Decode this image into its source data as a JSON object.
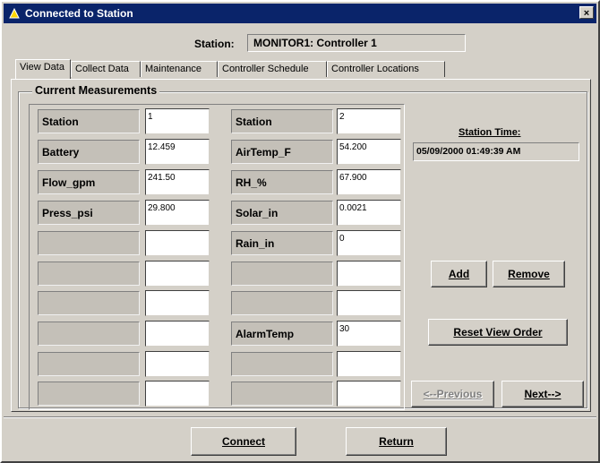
{
  "window": {
    "title": "Connected to Station",
    "close_glyph": "×"
  },
  "station": {
    "label": "Station:",
    "value": "MONITOR1: Controller 1"
  },
  "tabs": [
    {
      "label": "View Data"
    },
    {
      "label": "Collect Data"
    },
    {
      "label": "Maintenance"
    },
    {
      "label": "Controller Schedule"
    },
    {
      "label": "Controller Locations"
    }
  ],
  "group": {
    "label": "Current Measurements"
  },
  "left_column": [
    {
      "label": "Station",
      "value": "1"
    },
    {
      "label": "Battery",
      "value": "12.459"
    },
    {
      "label": "Flow_gpm",
      "value": "241.50"
    },
    {
      "label": "Press_psi",
      "value": "29.800"
    },
    {
      "label": "",
      "value": ""
    },
    {
      "label": "",
      "value": ""
    },
    {
      "label": "",
      "value": ""
    },
    {
      "label": "",
      "value": ""
    },
    {
      "label": "",
      "value": ""
    },
    {
      "label": "",
      "value": ""
    }
  ],
  "right_column": [
    {
      "label": "Station",
      "value": "2"
    },
    {
      "label": "AirTemp_F",
      "value": "54.200"
    },
    {
      "label": "RH_%",
      "value": "67.900"
    },
    {
      "label": "Solar_in",
      "value": "0.0021"
    },
    {
      "label": "Rain_in",
      "value": "0"
    },
    {
      "label": "",
      "value": ""
    },
    {
      "label": "",
      "value": ""
    },
    {
      "label": "AlarmTemp",
      "value": "30"
    },
    {
      "label": "",
      "value": ""
    },
    {
      "label": "",
      "value": ""
    }
  ],
  "station_time": {
    "label": "Station Time:",
    "value": "05/09/2000 01:49:39 AM"
  },
  "buttons": {
    "add": "Add",
    "remove": "Remove",
    "reset_view_order": "Reset View Order",
    "previous": "<--Previous",
    "next": "Next-->",
    "connect": "Connect",
    "return": "Return"
  },
  "colors": {
    "titlebar": "#0a246a",
    "face": "#d4d0c8",
    "label_cell": "#c4c0b8"
  }
}
